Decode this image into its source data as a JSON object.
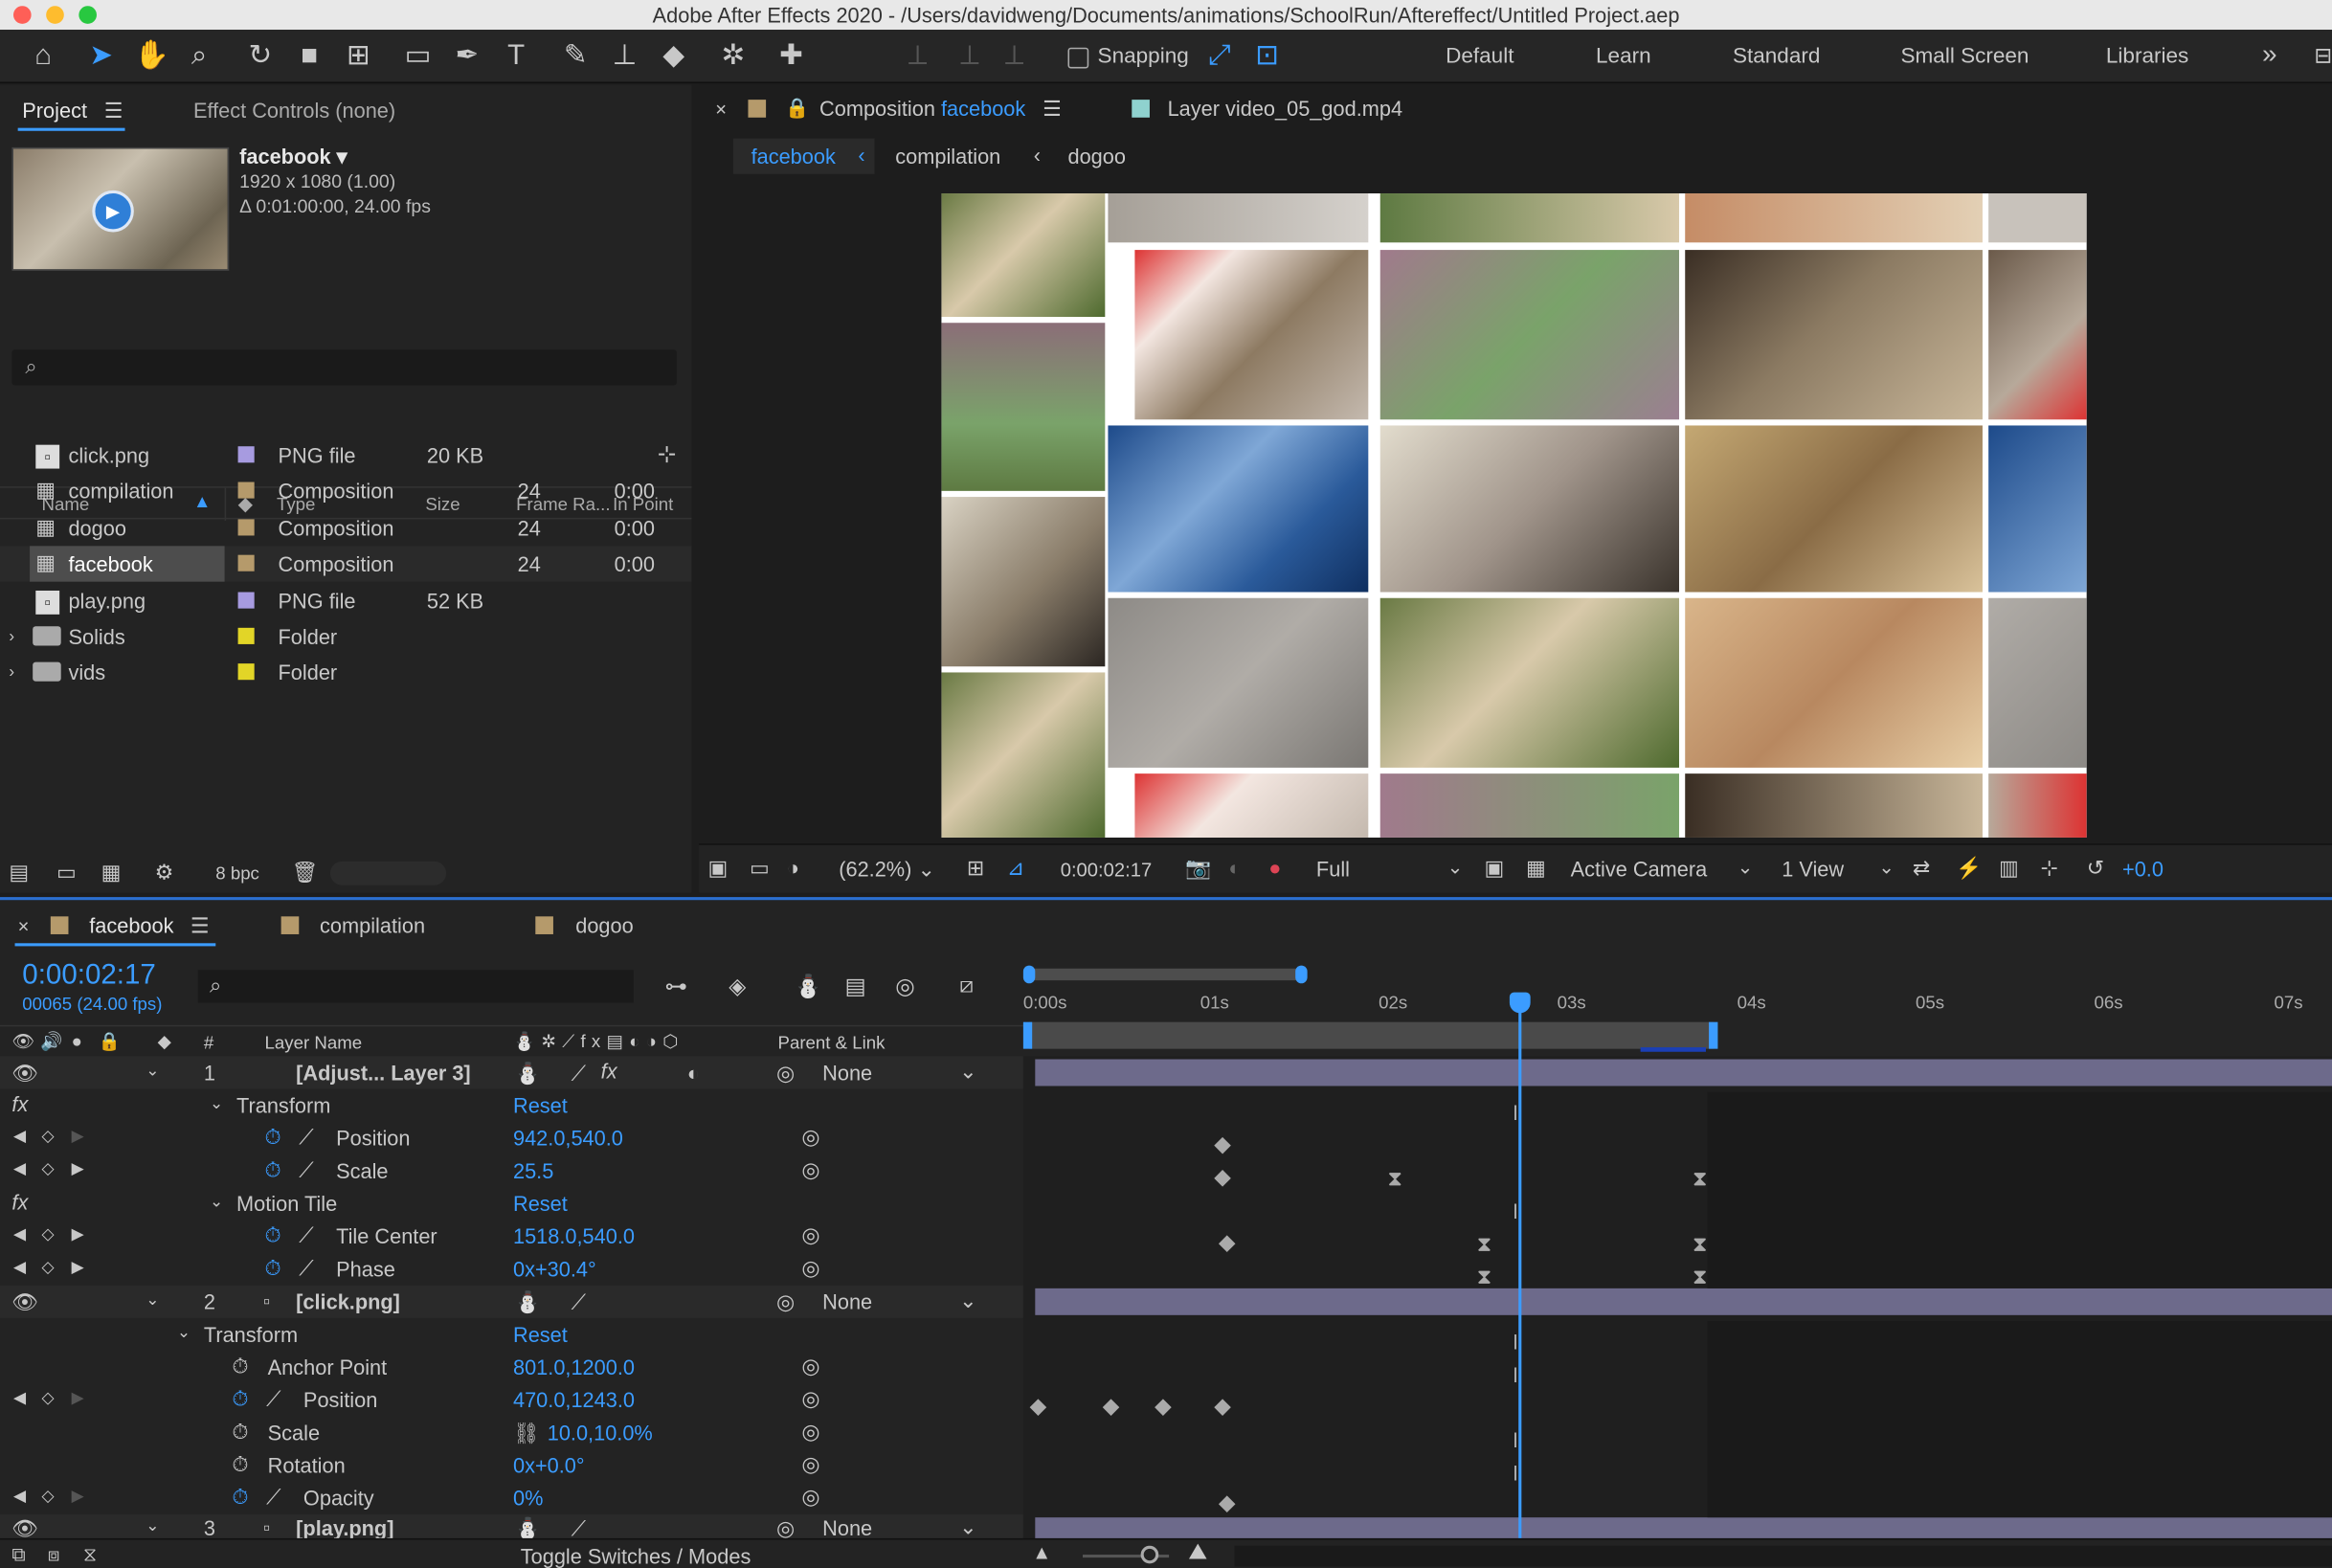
{
  "title": "Adobe After Effects 2020 - /Users/davidweng/Documents/animations/SchoolRun/Aftereffect/Untitled Project.aep",
  "toolbar": {
    "snapping": "Snapping",
    "workspaces": [
      "Default",
      "Learn",
      "Standard",
      "Small Screen",
      "Libraries"
    ]
  },
  "project": {
    "tab_project": "Project",
    "tab_effect": "Effect Controls (none)",
    "selected_name": "facebook",
    "selected_dims": "1920 x 1080 (1.00)",
    "selected_duration": "Δ 0:01:00:00, 24.00 fps",
    "columns": {
      "name": "Name",
      "type": "Type",
      "size": "Size",
      "frame_rate": "Frame Ra...",
      "in_point": "In Point"
    },
    "items": [
      {
        "name": "click.png",
        "type": "PNG file",
        "size": "20 KB",
        "fps": "",
        "in": ""
      },
      {
        "name": "compilation",
        "type": "Composition",
        "size": "",
        "fps": "24",
        "in": "0:00"
      },
      {
        "name": "dogoo",
        "type": "Composition",
        "size": "",
        "fps": "24",
        "in": "0:00"
      },
      {
        "name": "facebook",
        "type": "Composition",
        "size": "",
        "fps": "24",
        "in": "0:00"
      },
      {
        "name": "play.png",
        "type": "PNG file",
        "size": "52 KB",
        "fps": "",
        "in": ""
      },
      {
        "name": "Solids",
        "type": "Folder",
        "size": "",
        "fps": "",
        "in": ""
      },
      {
        "name": "vids",
        "type": "Folder",
        "size": "",
        "fps": "",
        "in": ""
      }
    ],
    "bpc": "8 bpc"
  },
  "comp": {
    "tab_prefix": "Composition",
    "tab_name": "facebook",
    "layer_tab": "Layer video_05_god.mp4",
    "breadcrumbs": [
      "facebook",
      "compilation",
      "dogoo"
    ],
    "zoom": "(62.2%)",
    "timecode": "0:00:02:17",
    "resolution": "Full",
    "camera": "Active Camera",
    "views": "1 View",
    "exposure": "+0.0"
  },
  "timeline": {
    "tabs": [
      "facebook",
      "compilation",
      "dogoo"
    ],
    "timecode": "0:00:02:17",
    "frames": "00065 (24.00 fps)",
    "col_layer_name": "Layer Name",
    "col_parent": "Parent & Link",
    "ruler": [
      "0:00s",
      "01s",
      "02s",
      "03s",
      "04s",
      "05s",
      "06s",
      "07s"
    ],
    "rows": [
      {
        "kind": "layer",
        "num": "1",
        "name": "[Adjust... Layer 3]",
        "parent": "None"
      },
      {
        "kind": "group",
        "name": "Transform",
        "value": "Reset"
      },
      {
        "kind": "prop",
        "name": "Position",
        "value": "942.0,540.0"
      },
      {
        "kind": "prop",
        "name": "Scale",
        "value": "25.5"
      },
      {
        "kind": "group",
        "name": "Motion Tile",
        "value": "Reset"
      },
      {
        "kind": "prop",
        "name": "Tile Center",
        "value": "1518.0,540.0"
      },
      {
        "kind": "prop",
        "name": "Phase",
        "value": "0x+30.4°"
      },
      {
        "kind": "layer",
        "num": "2",
        "name": "[click.png]",
        "parent": "None"
      },
      {
        "kind": "group",
        "name": "Transform",
        "value": "Reset"
      },
      {
        "kind": "prop",
        "name": "Anchor Point",
        "value": "801.0,1200.0"
      },
      {
        "kind": "prop",
        "name": "Position",
        "value": "470.0,1243.0"
      },
      {
        "kind": "prop",
        "name": "Scale",
        "value": "10.0,10.0%"
      },
      {
        "kind": "prop",
        "name": "Rotation",
        "value": "0x+0.0°"
      },
      {
        "kind": "prop",
        "name": "Opacity",
        "value": "0%"
      },
      {
        "kind": "layer",
        "num": "3",
        "name": "[play.png]",
        "parent": "None"
      }
    ],
    "toggle": "Toggle Switches / Modes"
  }
}
